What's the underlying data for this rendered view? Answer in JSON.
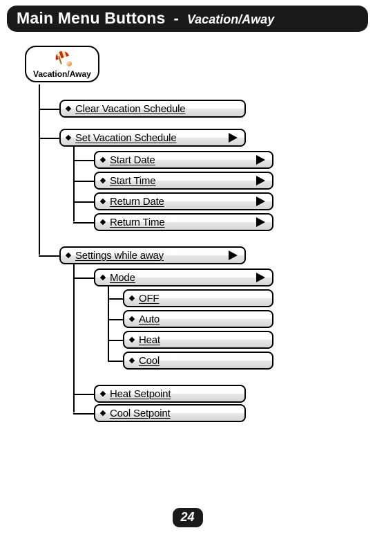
{
  "header": {
    "title": "Main Menu Buttons",
    "dash": "-",
    "subtitle": "Vacation/Away"
  },
  "root": {
    "label": "Vacation/Away"
  },
  "menu": {
    "clear_vacation": "Clear Vacation Schedule",
    "set_vacation": "Set Vacation Schedule",
    "set_sub": {
      "start_date": "Start Date",
      "start_time": "Start Time",
      "return_date": "Return Date",
      "return_time": "Return Time"
    },
    "settings_away": "Settings while away",
    "settings_sub": {
      "mode": "Mode",
      "mode_options": {
        "off": "OFF",
        "auto": "Auto",
        "heat": "Heat",
        "cool": "Cool"
      },
      "heat_setpoint": "Heat Setpoint",
      "cool_setpoint": "Cool Setpoint"
    }
  },
  "page_number": "24"
}
